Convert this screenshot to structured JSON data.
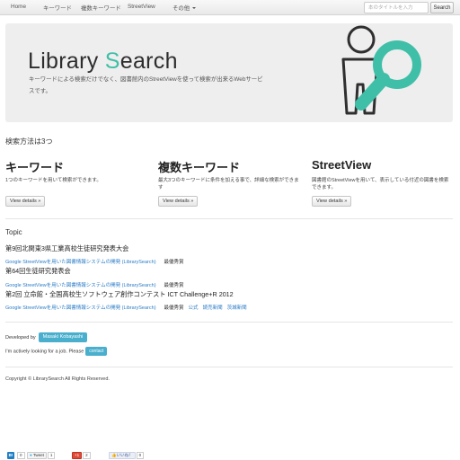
{
  "navbar": {
    "items": [
      {
        "label": "Home"
      },
      {
        "label": "キーワード"
      },
      {
        "label": "複数キーワード"
      },
      {
        "label": "StreetView"
      },
      {
        "label": "その他"
      }
    ],
    "search_placeholder": "本のタイトルを入力",
    "search_button": "Search"
  },
  "hero": {
    "title_main": "Library ",
    "title_accent_letter": "S",
    "title_rest": "earch",
    "description": "キーワードによる検索だけでなく、図書館内のStreetViewを使って検索が出来るWebサービスです。",
    "accent_color": "#3fbfa8"
  },
  "search_methods": {
    "heading": "検索方法は3つ",
    "columns": [
      {
        "title": "キーワード",
        "description": "1つのキーワードを用いて検索ができます。",
        "button": "View details »"
      },
      {
        "title": "複数キーワード",
        "description": "最大3つのキーワードに条件を加える事で、詳細な検索ができます",
        "button": "View details »"
      },
      {
        "title": "StreetView",
        "description": "図書館のStreetViewを用いて、表示している付近の図書を検索できます。",
        "button": "View details »"
      }
    ]
  },
  "topic": {
    "heading": "Topic",
    "events": [
      {
        "title": "第9回北関東3県工業高校生徒研究発表大会",
        "link": "Google StreetViewを用いた図書情報システムの開発 (LibrarySearch)",
        "award": "最優秀賞",
        "extra_links": []
      },
      {
        "title": "第64回生徒研究発表会",
        "link": "Google StreetViewを用いた図書情報システムの開発 (LibrarySearch)",
        "award": "最優秀賞",
        "extra_links": []
      },
      {
        "title": "第2回 立命館・全国高校生ソフトウェア創作コンテスト ICT Challenge+R 2012",
        "link": "Google StreetViewを用いた図書情報システムの開発 (LibrarySearch)",
        "award": "最優秀賞",
        "extra_links": [
          "公式",
          "読売新聞",
          "茨城新聞"
        ]
      }
    ]
  },
  "developer": {
    "label": "Developed by",
    "name": "Masaki Kobayashi",
    "job_text": "I'm actively looking for a job. Please",
    "contact_button": "contact"
  },
  "footer": {
    "copyright": "Copyright © LibrarySearch All Rights Reserved."
  },
  "social": {
    "hatena_label": "B!",
    "hatena_count": "0",
    "tweet_label": "Tweet",
    "tweet_count": "1",
    "gplus_label": "+1",
    "gplus_count": "2",
    "like_label": "いいね！",
    "like_count": "0"
  }
}
